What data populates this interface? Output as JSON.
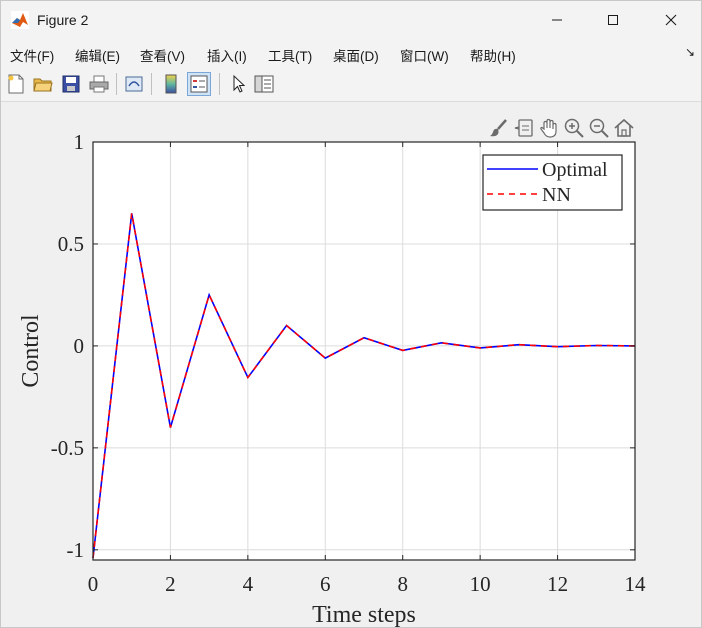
{
  "window": {
    "title": "Figure 2"
  },
  "menu": {
    "items": [
      "文件(F)",
      "编辑(E)",
      "查看(V)",
      "插入(I)",
      "工具(T)",
      "桌面(D)",
      "窗口(W)",
      "帮助(H)"
    ]
  },
  "toolbar": {
    "buttons": [
      "new-figure-icon",
      "open-icon",
      "save-icon",
      "print-icon",
      "link-plot-icon",
      "insert-colorbar-icon",
      "insert-legend-icon",
      "edit-plot-icon",
      "property-inspector-icon"
    ]
  },
  "axes_toolbar": [
    "brush-icon",
    "data-tips-icon",
    "pan-icon",
    "zoom-in-icon",
    "zoom-out-icon",
    "restore-view-icon"
  ],
  "colors": {
    "optimal": "#0000ff",
    "nn": "#ff0000",
    "grid": "#dcdcdc"
  },
  "chart_data": {
    "type": "line",
    "title": "",
    "xlabel": "Time steps",
    "ylabel": "Control",
    "xlim": [
      0,
      14
    ],
    "ylim": [
      -1.05,
      1
    ],
    "xticks": [
      0,
      2,
      4,
      6,
      8,
      10,
      12,
      14
    ],
    "xtick_labels": [
      "0",
      "2",
      "4",
      "6",
      "8",
      "10",
      "12",
      "14"
    ],
    "yticks": [
      -1,
      -0.5,
      0,
      0.5,
      1
    ],
    "ytick_labels": [
      "-1",
      "-0.5",
      "0",
      "0.5",
      "1"
    ],
    "grid": true,
    "legend_position": "top-right",
    "x": [
      0,
      1,
      2,
      3,
      4,
      5,
      6,
      7,
      8,
      9,
      10,
      11,
      12,
      13,
      14
    ],
    "series": [
      {
        "name": "Optimal",
        "style": "solid",
        "color": "#0000ff",
        "values": [
          -1.04,
          0.65,
          -0.4,
          0.25,
          -0.155,
          0.1,
          -0.06,
          0.04,
          -0.022,
          0.015,
          -0.01,
          0.006,
          -0.004,
          0.002,
          0.0
        ]
      },
      {
        "name": "NN",
        "style": "dashed",
        "color": "#ff0000",
        "values": [
          -1.04,
          0.65,
          -0.4,
          0.25,
          -0.155,
          0.1,
          -0.06,
          0.04,
          -0.022,
          0.015,
          -0.01,
          0.006,
          -0.004,
          0.002,
          0.0
        ]
      }
    ]
  }
}
